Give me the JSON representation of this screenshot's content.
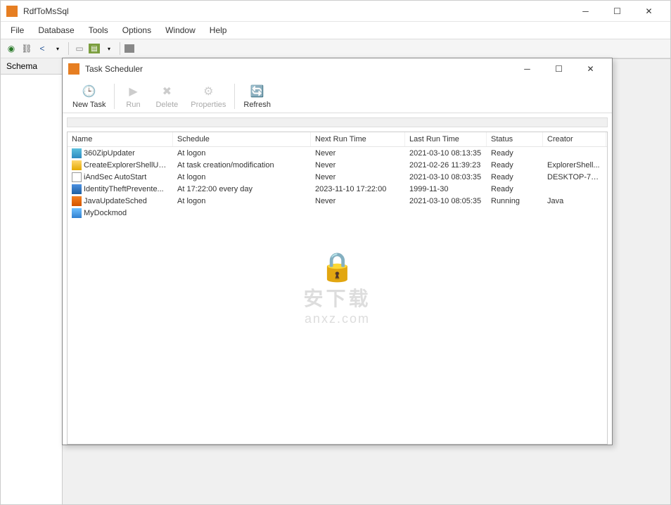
{
  "main": {
    "title": "RdfToMsSql",
    "menu": [
      "File",
      "Database",
      "Tools",
      "Options",
      "Window",
      "Help"
    ],
    "sidebar_tab": "Schema"
  },
  "dialog": {
    "title": "Task Scheduler",
    "toolbar": {
      "new_task": "New Task",
      "run": "Run",
      "delete": "Delete",
      "properties": "Properties",
      "refresh": "Refresh"
    },
    "columns": {
      "name": "Name",
      "schedule": "Schedule",
      "next": "Next Run Time",
      "last": "Last Run Time",
      "status": "Status",
      "creator": "Creator"
    },
    "rows": [
      {
        "icon": "icon-zip",
        "name": "360ZipUpdater",
        "schedule": "At logon",
        "next": "Never",
        "last": "2021-03-10 08:13:35",
        "status": "Ready",
        "creator": ""
      },
      {
        "icon": "icon-folder",
        "name": "CreateExplorerShellUn...",
        "schedule": "At task creation/modification",
        "next": "Never",
        "last": "2021-02-26 11:39:23",
        "status": "Ready",
        "creator": "ExplorerShell..."
      },
      {
        "icon": "icon-doc",
        "name": "iAndSec AutoStart",
        "schedule": "At logon",
        "next": "Never",
        "last": "2021-03-10 08:03:35",
        "status": "Ready",
        "creator": "DESKTOP-7E..."
      },
      {
        "icon": "icon-shield",
        "name": "IdentityTheftPrevente...",
        "schedule": "At 17:22:00 every day",
        "next": "2023-11-10 17:22:00",
        "last": "1999-11-30",
        "status": "Ready",
        "creator": ""
      },
      {
        "icon": "icon-java",
        "name": "JavaUpdateSched",
        "schedule": "At logon",
        "next": "Never",
        "last": "2021-03-10 08:05:35",
        "status": "Running",
        "creator": "Java"
      },
      {
        "icon": "icon-app",
        "name": "MyDockmod",
        "schedule": "",
        "next": "",
        "last": "",
        "status": "",
        "creator": ""
      }
    ]
  },
  "watermark": {
    "main": "安下载",
    "sub": "anxz.com"
  }
}
